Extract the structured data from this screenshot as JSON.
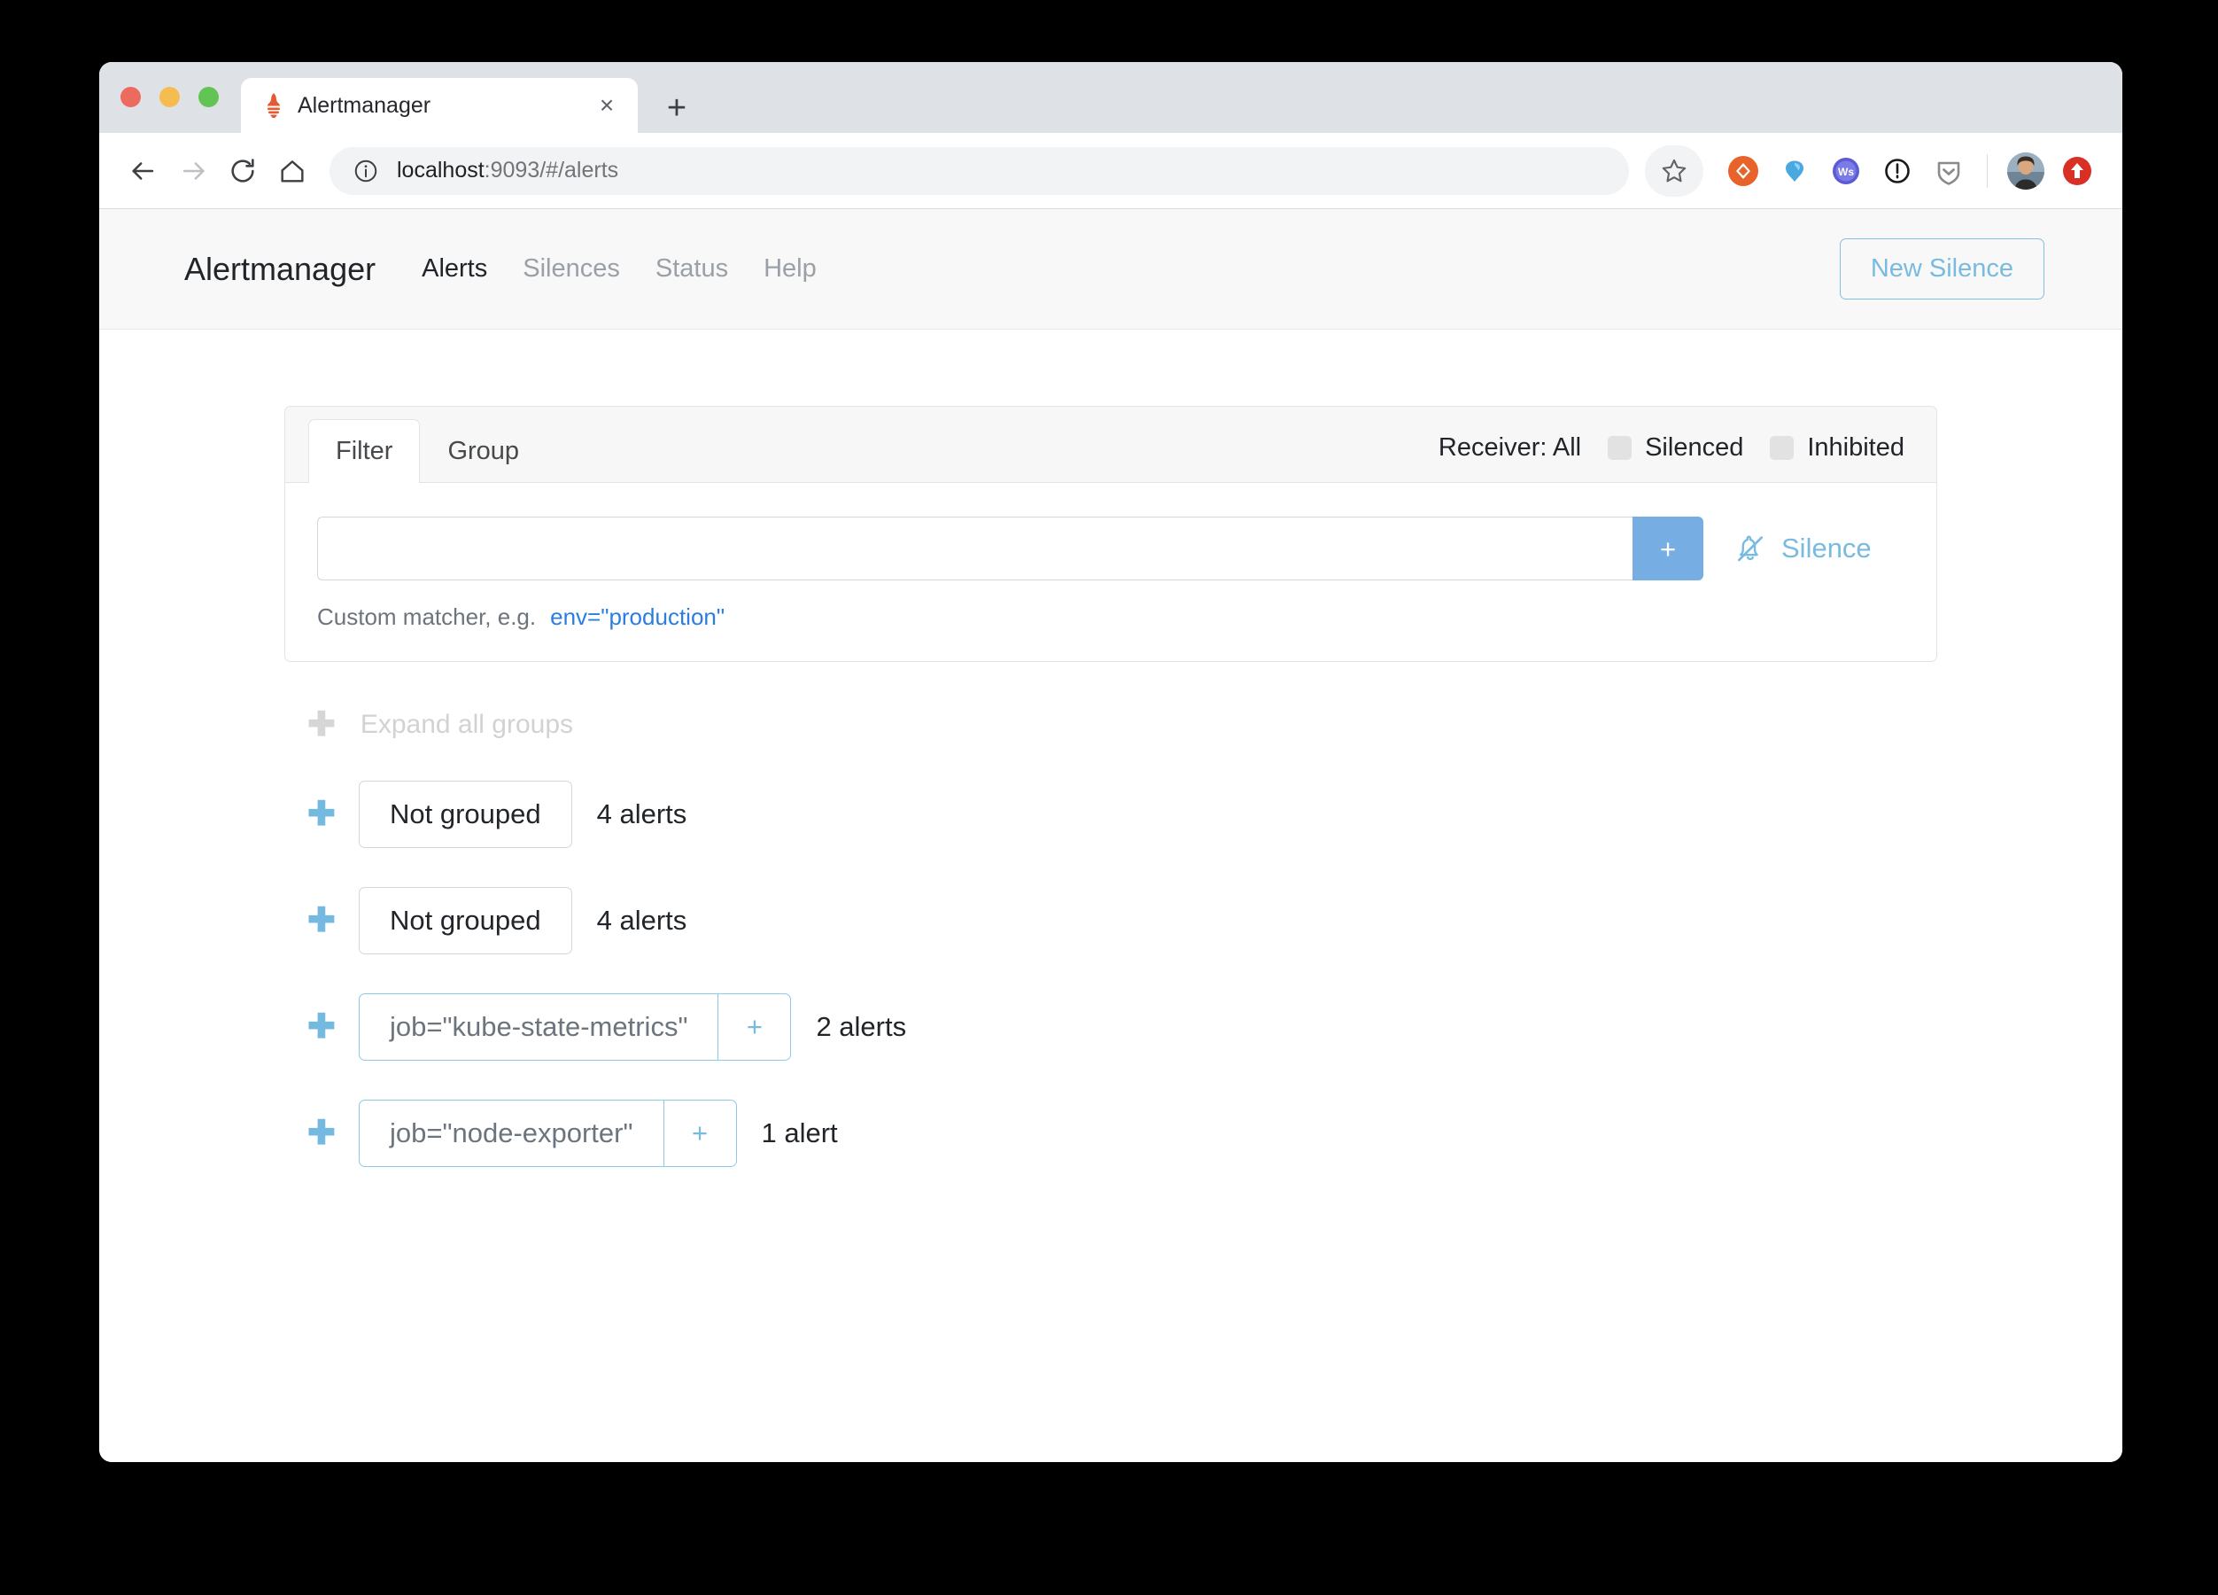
{
  "browser": {
    "tab": {
      "title": "Alertmanager",
      "favicon": "prometheus-torch-icon",
      "close_label": "×"
    },
    "new_tab_label": "+",
    "toolbar": {
      "back_icon": "back-arrow-icon",
      "forward_icon": "forward-arrow-icon",
      "reload_icon": "reload-icon",
      "home_icon": "home-icon",
      "info_icon": "info-circle-icon",
      "url_host": "localhost",
      "url_rest": ":9093/#/alerts",
      "star_icon": "bookmark-star-icon",
      "extensions": [
        {
          "name": "orange-diamond-extension-icon",
          "color": "#E8622C"
        },
        {
          "name": "blue-gem-extension-icon",
          "color": "#4AA8E0"
        },
        {
          "name": "ws-badge-extension-icon",
          "color": "#5B5BD6"
        },
        {
          "name": "onepassword-extension-icon",
          "color": "#1A1A1A"
        },
        {
          "name": "pocket-shield-extension-icon",
          "color": "#8A8A8A"
        }
      ],
      "avatar_name": "user-avatar",
      "profile_action_icon": "red-up-arrow-icon"
    }
  },
  "app": {
    "brand": "Alertmanager",
    "nav": [
      {
        "label": "Alerts",
        "active": true
      },
      {
        "label": "Silences",
        "active": false
      },
      {
        "label": "Status",
        "active": false
      },
      {
        "label": "Help",
        "active": false
      }
    ],
    "new_silence_button": "New Silence"
  },
  "filter_panel": {
    "tabs": [
      {
        "label": "Filter",
        "active": true
      },
      {
        "label": "Group",
        "active": false
      }
    ],
    "receiver_label": "Receiver: All",
    "checkboxes": [
      {
        "label": "Silenced",
        "checked": false
      },
      {
        "label": "Inhibited",
        "checked": false
      }
    ],
    "matcher_input_value": "",
    "matcher_input_placeholder": "",
    "add_button_label": "+",
    "silence_link_label": "Silence",
    "silence_link_icon": "bell-slash-icon",
    "hint_prefix": "Custom matcher, e.g.",
    "hint_example": "env=\"production\""
  },
  "groups": {
    "expand_all_label": "Expand all groups",
    "expand_all_icon": "plus-icon",
    "items": [
      {
        "label": "Not grouped",
        "count_label": "4 alerts",
        "style": "plain",
        "has_add_button": false,
        "add_button_label": "+"
      },
      {
        "label": "Not grouped",
        "count_label": "4 alerts",
        "style": "plain",
        "has_add_button": false,
        "add_button_label": "+"
      },
      {
        "label": "job=\"kube-state-metrics\"",
        "count_label": "2 alerts",
        "style": "matcher",
        "has_add_button": true,
        "add_button_label": "+"
      },
      {
        "label": "job=\"node-exporter\"",
        "count_label": "1 alert",
        "style": "matcher",
        "has_add_button": true,
        "add_button_label": "+"
      }
    ]
  },
  "colors": {
    "accent_blue": "#76aee3",
    "link_blue": "#79bbe0",
    "example_blue": "#2b7de1",
    "prometheus_orange": "#e35a35",
    "titlebar": "#dee1e6"
  }
}
